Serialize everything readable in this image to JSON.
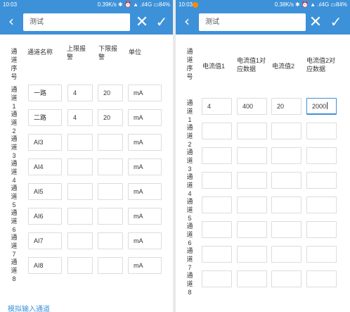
{
  "left": {
    "status": {
      "time": "10:03",
      "right": "0.39K/s ✱ ⏰ ▲ .ıl4G ▭84%"
    },
    "toolbar": {
      "title_value": "测试",
      "back_icon": "chevron-left-icon",
      "close_icon": "close-icon",
      "confirm_icon": "check-icon"
    },
    "headers": {
      "seq": "通道序号",
      "name": "通道名称",
      "upper": "上限报警",
      "lower": "下限报警",
      "unit": "单位"
    },
    "rows": [
      {
        "label": "通道1",
        "name": "一路",
        "upper": "4",
        "lower": "20",
        "unit": "mA"
      },
      {
        "label": "通道2",
        "name": "二路",
        "upper": "4",
        "lower": "20",
        "unit": "mA"
      },
      {
        "label": "通道3",
        "name": "AI3",
        "upper": "",
        "lower": "",
        "unit": "mA"
      },
      {
        "label": "通道4",
        "name": "AI4",
        "upper": "",
        "lower": "",
        "unit": "mA"
      },
      {
        "label": "通道5",
        "name": "AI5",
        "upper": "",
        "lower": "",
        "unit": "mA"
      },
      {
        "label": "通道6",
        "name": "AI6",
        "upper": "",
        "lower": "",
        "unit": "mA"
      },
      {
        "label": "通道7",
        "name": "AI7",
        "upper": "",
        "lower": "",
        "unit": "mA"
      },
      {
        "label": "通道8",
        "name": "AI8",
        "upper": "",
        "lower": "",
        "unit": "mA"
      }
    ],
    "bottom_link": "模拟输入通道"
  },
  "right": {
    "status": {
      "time": "10:03",
      "right": "0.38K/s ✱ ⏰ ▲ .ıl4G ▭84%"
    },
    "toolbar": {
      "title_value": "测试",
      "back_icon": "chevron-left-icon",
      "close_icon": "close-icon",
      "confirm_icon": "check-icon"
    },
    "headers": {
      "seq": "通道序号",
      "current1": "电流值1",
      "data1": "电流值1对应数据",
      "current2": "电流值2",
      "data2": "电流值2对应数据"
    },
    "rows": [
      {
        "label": "通道1",
        "current1": "4",
        "data1": "400",
        "current2": "20",
        "data2": "2000",
        "focused": true
      },
      {
        "label": "通道2",
        "current1": "",
        "data1": "",
        "current2": "",
        "data2": ""
      },
      {
        "label": "通道3",
        "current1": "",
        "data1": "",
        "current2": "",
        "data2": ""
      },
      {
        "label": "通道4",
        "current1": "",
        "data1": "",
        "current2": "",
        "data2": ""
      },
      {
        "label": "通道5",
        "current1": "",
        "data1": "",
        "current2": "",
        "data2": ""
      },
      {
        "label": "通道6",
        "current1": "",
        "data1": "",
        "current2": "",
        "data2": ""
      },
      {
        "label": "通道7",
        "current1": "",
        "data1": "",
        "current2": "",
        "data2": ""
      },
      {
        "label": "通道8",
        "current1": "",
        "data1": "",
        "current2": "",
        "data2": ""
      }
    ]
  },
  "colors": {
    "primary": "#3d91d8",
    "border": "#dcdcdc",
    "notification_dot": "#ff8a00"
  }
}
